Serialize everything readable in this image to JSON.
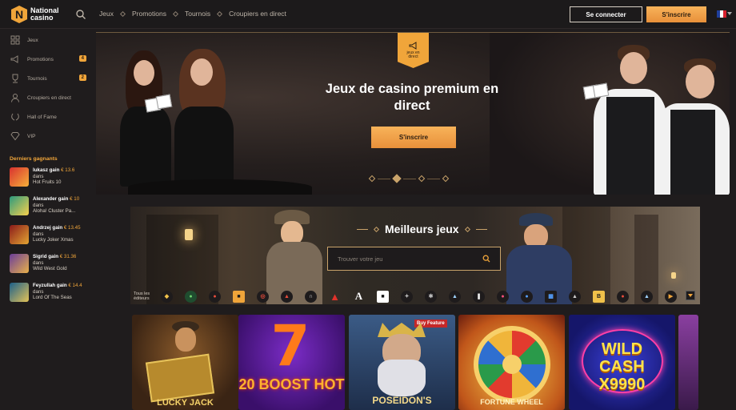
{
  "header": {
    "logo_text": "National\ncasino",
    "logo_letter": "N",
    "nav": [
      "Jeux",
      "Promotions",
      "Tournois",
      "Croupiers en direct"
    ],
    "login_label": "Se connecter",
    "signup_label": "S'inscrire",
    "accent_color": "#f0a53a"
  },
  "sidebar": {
    "items": [
      {
        "label": "Jeux",
        "icon": "games-grid-icon"
      },
      {
        "label": "Promotions",
        "icon": "megaphone-icon",
        "badge": "4"
      },
      {
        "label": "Tournois",
        "icon": "trophy-icon",
        "badge": "2"
      },
      {
        "label": "Croupiers en direct",
        "icon": "dealer-icon"
      },
      {
        "label": "Hall of Fame",
        "icon": "laurel-icon"
      },
      {
        "label": "VIP",
        "icon": "diamond-icon"
      }
    ],
    "winners_title": "Derniers gagnants",
    "winners": [
      {
        "name": "lukasz gain",
        "amount": "€ 13.6",
        "word": "dans",
        "game": "Hot Fruits 10"
      },
      {
        "name": "Alexander gain",
        "amount": "€ 10",
        "word": "dans",
        "game": "Aloha! Cluster Pa..."
      },
      {
        "name": "Andrzej gain",
        "amount": "€ 13.45",
        "word": "dans",
        "game": "Lucky Joker Xmas"
      },
      {
        "name": "Sigrid gain",
        "amount": "€ 31.36",
        "word": "dans",
        "game": "Wild West Gold"
      },
      {
        "name": "Feyzullah gain",
        "amount": "€ 14.4",
        "word": "dans",
        "game": "Lord Of The Seas"
      }
    ]
  },
  "hero": {
    "tag_label": "jeux en direct",
    "title": "Jeux de casino premium en direct",
    "cta_label": "S'inscrire",
    "slides": 4,
    "active_slide": 2
  },
  "games": {
    "title": "Meilleurs jeux",
    "search_placeholder": "Trouver votre jeu",
    "all_providers_label": "Tous les éditeurs",
    "providers": [
      "P1",
      "P2",
      "P3",
      "P4",
      "P5",
      "P6",
      "P7",
      "P8",
      "P9",
      "A",
      "P11",
      "P12",
      "P13",
      "P14",
      "P15",
      "P16",
      "P17",
      "P18",
      "B",
      "P20",
      "P21",
      "P22"
    ],
    "cards": [
      {
        "title": "LUCKY JACK"
      },
      {
        "title": "20 BOOST HOT"
      },
      {
        "title": "POSEIDON'S",
        "tag": "Buy Feature"
      },
      {
        "title": "FORTUNE WHEEL"
      },
      {
        "title": "WILD CASH X9990"
      }
    ]
  }
}
